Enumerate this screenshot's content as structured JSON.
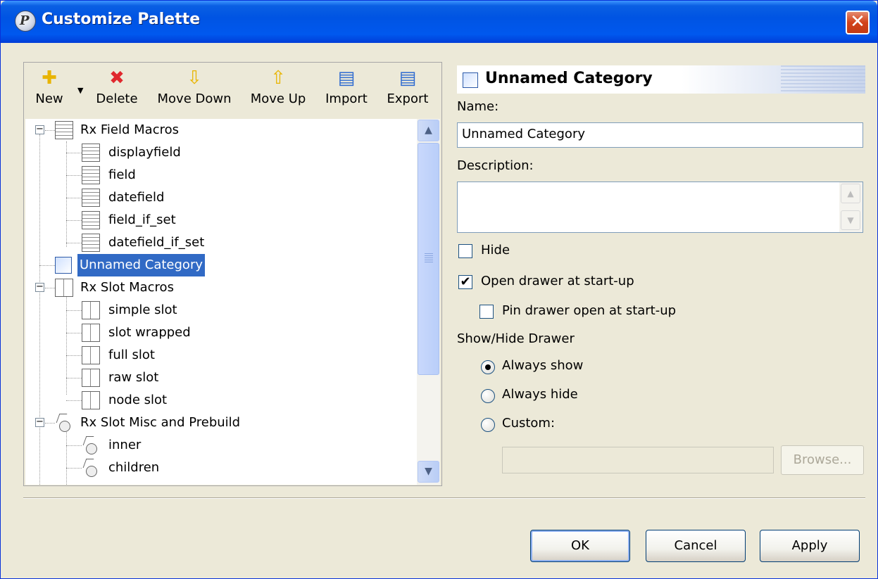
{
  "window": {
    "title": "Customize Palette",
    "close_glyph": "✕",
    "app_icon_glyph": "P"
  },
  "toolbar": {
    "new_label": "New",
    "delete_label": "Delete",
    "move_down_label": "Move Down",
    "move_up_label": "Move Up",
    "import_label": "Import",
    "export_label": "Export"
  },
  "tree": {
    "groups": [
      {
        "label": "Rx Field Macros",
        "icon": "macro-icon",
        "children": [
          "displayfield",
          "field",
          "datefield",
          "field_if_set",
          "datefield_if_set"
        ]
      },
      {
        "label": "Unnamed Category",
        "icon": "category-icon",
        "selected": true
      },
      {
        "label": "Rx Slot Macros",
        "icon": "slot-icon",
        "children": [
          "simple slot",
          "slot wrapped",
          "full slot",
          "raw slot",
          "node slot"
        ]
      },
      {
        "label": "Rx Slot Misc and Prebuild",
        "icon": "misc-icon",
        "children": [
          "inner",
          "children"
        ]
      }
    ]
  },
  "details": {
    "header_title": "Unnamed Category",
    "name_label": "Name:",
    "name_value": "Unnamed Category",
    "description_label": "Description:",
    "description_value": "",
    "hide_label": "Hide",
    "hide_checked": false,
    "open_drawer_label": "Open drawer at start-up",
    "open_drawer_checked": true,
    "pin_drawer_label": "Pin drawer open at start-up",
    "pin_drawer_checked": false,
    "show_hide_label": "Show/Hide Drawer",
    "always_show_label": "Always show",
    "always_hide_label": "Always hide",
    "custom_label": "Custom:",
    "selected_option": "Always show",
    "custom_value": "",
    "browse_label": "Browse..."
  },
  "buttons": {
    "ok_label": "OK",
    "cancel_label": "Cancel",
    "apply_label": "Apply"
  },
  "colors": {
    "titlebar": "#0054e3",
    "selection": "#316ac5",
    "dialog_bg": "#ece9d8"
  }
}
